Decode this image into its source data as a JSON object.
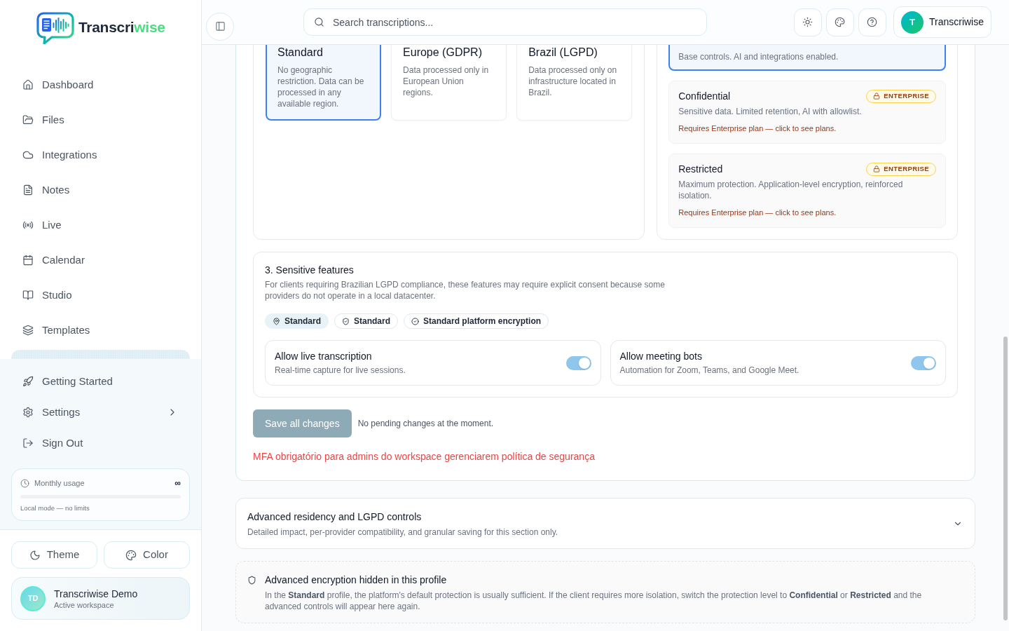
{
  "sidebar": {
    "logo": {
      "name": "Transcri",
      "accent": "wise"
    },
    "nav": [
      {
        "label": "Dashboard",
        "selected": false
      },
      {
        "label": "Files",
        "selected": false
      },
      {
        "label": "Integrations",
        "selected": false
      },
      {
        "label": "Notes",
        "selected": false
      },
      {
        "label": "Live",
        "selected": false
      },
      {
        "label": "Calendar",
        "selected": false
      },
      {
        "label": "Studio",
        "selected": false
      },
      {
        "label": "Templates",
        "selected": false
      }
    ],
    "secondary_nav": [
      {
        "label": "Getting Started",
        "kind": "link"
      },
      {
        "label": "Settings",
        "kind": "submenu"
      },
      {
        "label": "Sign Out",
        "kind": "link"
      }
    ],
    "usage": {
      "title": "Monthly usage",
      "limit": "∞",
      "note": "Local mode — no limits"
    },
    "buttons": [
      "Theme",
      "Color"
    ],
    "workspace": {
      "initials": "TD",
      "name": "Transcriwise Demo",
      "role": "Active workspace"
    }
  },
  "header": {
    "search": {
      "placeholder": "Search transcriptions..."
    },
    "user": {
      "initial": "T",
      "name": "Transcriwise"
    }
  },
  "residency_options": [
    {
      "title": "Standard",
      "description": "No geographic restriction. Data can be processed in any available region.",
      "selected": true
    },
    {
      "title": "Europe (GDPR)",
      "description": "Data processed only in European Union regions.",
      "selected": false
    },
    {
      "title": "Brazil (LGPD)",
      "description": "Data processed only on infrastructure located in Brazil.",
      "selected": false
    }
  ],
  "protection_levels": [
    {
      "description": "Base controls. AI and integrations enabled.",
      "selected": true
    },
    {
      "title": "Confidential",
      "badge": "ENTERPRISE",
      "description": "Sensitive data. Limited retention, AI with allowlist.",
      "note": "Requires Enterprise plan — click to see plans.",
      "selected": false
    },
    {
      "title": "Restricted",
      "badge": "ENTERPRISE",
      "description": "Maximum protection. Application-level encryption, reinforced isolation.",
      "note": "Requires Enterprise plan — click to see plans.",
      "selected": false
    }
  ],
  "sensitive_features": {
    "title": "3. Sensitive features",
    "description": "For clients requiring Brazilian LGPD compliance, these features may require explicit consent because some providers do not operate in a local datacenter.",
    "chips": [
      {
        "label": "Standard",
        "kind": "region"
      },
      {
        "label": "Standard",
        "kind": "protection"
      },
      {
        "label": "Standard platform encryption",
        "kind": "encryption"
      }
    ],
    "toggles": [
      {
        "title": "Allow live transcription",
        "description": "Real-time capture for live sessions.",
        "on": true
      },
      {
        "title": "Allow meeting bots",
        "description": "Automation for Zoom, Teams, and Google Meet.",
        "on": true
      }
    ]
  },
  "save": {
    "label": "Save all changes",
    "disabled": true,
    "status": "No pending changes at the moment."
  },
  "error": "MFA obrigatório para admins do workspace gerenciarem política de segurança",
  "advanced": {
    "title": "Advanced residency and LGPD controls",
    "description": "Detailed impact, per-provider compatibility, and granular saving for this section only.",
    "expanded": false
  },
  "encryption_notice": {
    "title": "Advanced encryption hidden in this profile",
    "text": "In the **Standard** profile, the platform's default protection is usually sufficient. If the client requires more isolation, switch the protection level to **Confidential** or **Restricted** and the advanced controls will appear here again."
  }
}
